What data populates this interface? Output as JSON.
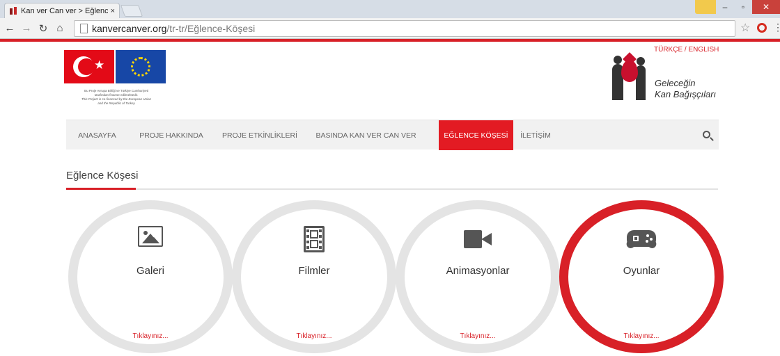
{
  "browser": {
    "tab_title": "Kan ver Can ver > Eğlence",
    "tab_close": "×",
    "url_host": "kanvercanver.org",
    "url_path": "/tr-tr/Eğlence-Köşesi"
  },
  "header": {
    "funding_note_tr_1": "Bu Proje Avrupa Birliği ve Türkiye Cumhuriyeti",
    "funding_note_tr_2": "tarafından finanse edilmektedir.",
    "funding_note_en_1": "This Project is co-financed by the European Union",
    "funding_note_en_2": "and the Republic of Turkey",
    "language_switch": "TÜRKÇE / ENGLISH",
    "brand_line_1": "Geleceğin",
    "brand_line_2": "Kan Bağışçıları"
  },
  "nav": {
    "items": [
      {
        "label": "ANASAYFA"
      },
      {
        "label": "PROJE HAKKINDA"
      },
      {
        "label": "PROJE ETKİNLİKLERİ"
      },
      {
        "label": "BASINDA KAN VER CAN VER"
      },
      {
        "label": "EĞLENCE KÖŞESİ",
        "active": true
      },
      {
        "label": "İLETİŞİM"
      }
    ]
  },
  "section": {
    "title": "Eğlence Köşesi"
  },
  "cards": [
    {
      "label": "Galeri",
      "link": "Tıklayınız...",
      "icon": "image-icon"
    },
    {
      "label": "Filmler",
      "link": "Tıklayınız...",
      "icon": "film-icon"
    },
    {
      "label": "Animasyonlar",
      "link": "Tıklayınız...",
      "icon": "video-camera-icon"
    },
    {
      "label": "Oyunlar",
      "link": "Tıklayınız...",
      "icon": "gamepad-icon",
      "active": true
    }
  ],
  "colors": {
    "accent": "#d82027",
    "circle_border": "#e4e4e4"
  }
}
